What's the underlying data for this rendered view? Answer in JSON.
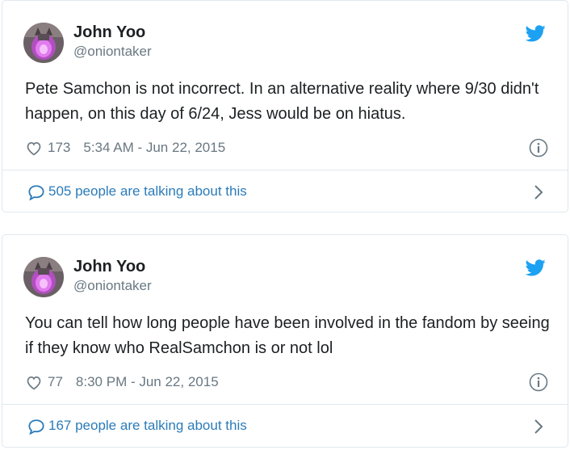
{
  "colors": {
    "text": "#1c2022",
    "muted": "#697882",
    "link": "#2b7bb9",
    "twitter_blue": "#1da1f2",
    "border": "#e1e8ed"
  },
  "tweets": [
    {
      "author_name": "John Yoo",
      "author_handle": "@oniontaker",
      "text": "Pete Samchon is not incorrect. In an alternative reality where 9/30 didn't happen, on this day of 6/24, Jess would be on hiatus.",
      "likes": "173",
      "timestamp": "5:34 AM - Jun 22, 2015",
      "talking": "505 people are talking about this"
    },
    {
      "author_name": "John Yoo",
      "author_handle": "@oniontaker",
      "text": "You can tell how long people have been involved in the fandom by seeing if they know who RealSamchon is or not lol",
      "likes": "77",
      "timestamp": "8:30 PM - Jun 22, 2015",
      "talking": "167 people are talking about this"
    }
  ],
  "icons": {
    "avatar": "avatar",
    "brand": "twitter-bird-icon",
    "like": "heart-icon",
    "info": "info-icon",
    "reply": "speech-bubble-icon",
    "more": "chevron-right-icon"
  }
}
